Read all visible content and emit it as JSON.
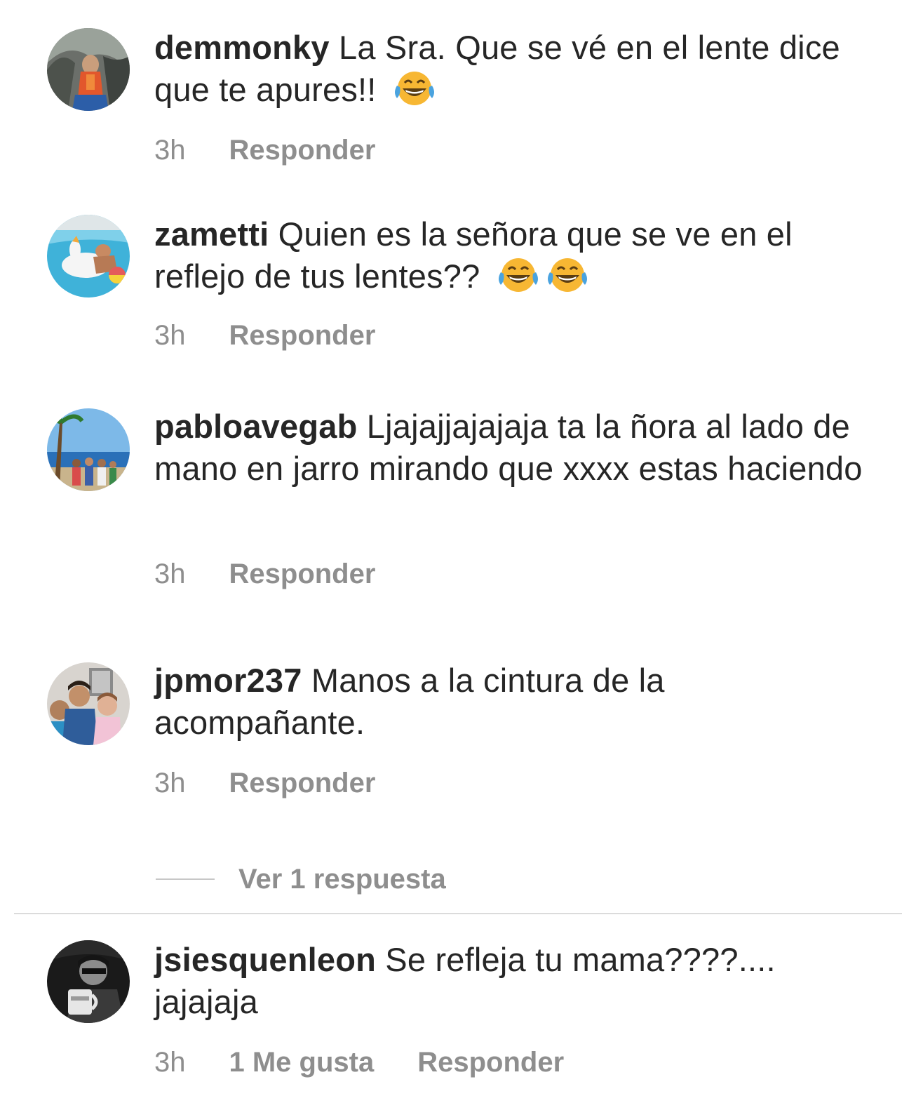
{
  "comments": [
    {
      "username": "demmonky",
      "text": "La Sra. Que se vé en el lente dice que te apures!!",
      "emojis": [
        "face-with-tears-of-joy"
      ],
      "time": "3h",
      "likes": "",
      "reply_label": "Responder"
    },
    {
      "username": "zametti",
      "text": "Quien es la señora que se ve en el reflejo de tus lentes??",
      "emojis": [
        "face-with-tears-of-joy",
        "face-with-tears-of-joy"
      ],
      "time": "3h",
      "likes": "",
      "reply_label": "Responder"
    },
    {
      "username": "pabloavegab",
      "text": "Ljajajjajajaja ta la ñora al lado de mano en jarro mirando que xxxx estas haciendo",
      "emojis": [],
      "time": "3h",
      "likes": "",
      "reply_label": "Responder"
    },
    {
      "username": "jpmor237",
      "text": "Manos a la cintura de la acompañante.",
      "emojis": [],
      "time": "3h",
      "likes": "",
      "reply_label": "Responder",
      "view_replies_label": "Ver 1 respuesta"
    },
    {
      "username": "jsiesquenleon",
      "text": "Se refleja tu mama????.... jajajaja",
      "emojis": [],
      "time": "3h",
      "likes": "1 Me gusta",
      "reply_label": "Responder"
    }
  ],
  "colors": {
    "text_primary": "#262626",
    "text_secondary": "#8e8e8e",
    "divider": "#dbdbdb",
    "emoji_yellow": "#f7b733"
  }
}
